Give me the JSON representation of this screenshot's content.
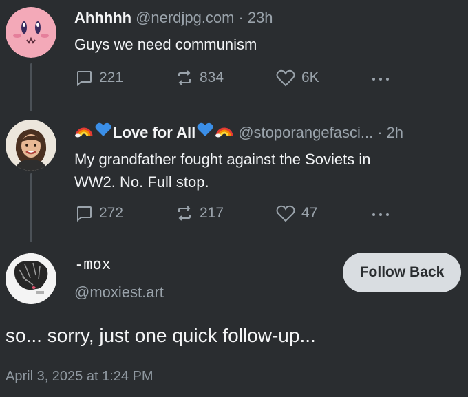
{
  "post1": {
    "author": "Ahhhhh",
    "handle": "@nerdjpg.com",
    "separator": "·",
    "time": "23h",
    "text": "Guys we need communism",
    "replies": "221",
    "reposts": "834",
    "likes": "6K",
    "avatar_icon": "kirby-face-avatar"
  },
  "post2": {
    "author": "Love for All",
    "handle": "@stoporangefasci...",
    "separator": "·",
    "time": "2h",
    "text_line1": "My grandfather fought against the Soviets in",
    "text_line2": "WW2. No. Full stop.",
    "replies": "272",
    "reposts": "217",
    "likes": "47",
    "name_decorations": [
      "rainbow-emoji",
      "blue-heart-emoji",
      "blue-heart-emoji",
      "rainbow-emoji"
    ]
  },
  "post3": {
    "author": "-mox",
    "handle": "@moxiest.art",
    "follow_label": "Follow Back",
    "text": "so... sorry, just one quick follow-up...",
    "timestamp": "April 3, 2025 at 1:24 PM"
  },
  "colors": {
    "background": "#2a2d30",
    "text": "#f1f3f5",
    "muted": "#9aa3ab",
    "button_bg": "#d9dde1",
    "kirby_pink": "#f3a9b8"
  }
}
